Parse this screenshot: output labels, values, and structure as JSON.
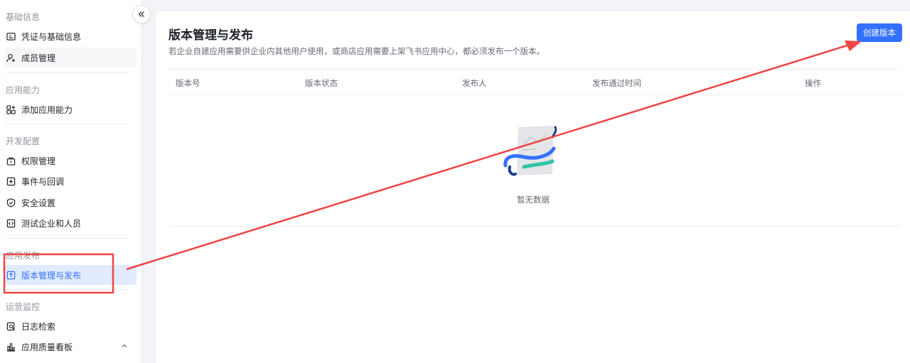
{
  "sidebar": {
    "sections": [
      {
        "title": "基础信息",
        "items": [
          {
            "label": "凭证与基础信息",
            "icon": "credential-icon"
          },
          {
            "label": "成员管理",
            "icon": "member-icon"
          }
        ]
      },
      {
        "title": "应用能力",
        "items": [
          {
            "label": "添加应用能力",
            "icon": "add-capability-icon"
          }
        ]
      },
      {
        "title": "开发配置",
        "items": [
          {
            "label": "权限管理",
            "icon": "lock-icon"
          },
          {
            "label": "事件与回调",
            "icon": "event-icon"
          },
          {
            "label": "安全设置",
            "icon": "shield-icon"
          },
          {
            "label": "测试企业和人员",
            "icon": "code-icon"
          }
        ]
      },
      {
        "title": "应用发布",
        "items": [
          {
            "label": "版本管理与发布",
            "icon": "upload-icon"
          }
        ]
      },
      {
        "title": "运营监控",
        "items": [
          {
            "label": "日志检索",
            "icon": "log-search-icon"
          },
          {
            "label": "应用质量看板",
            "icon": "bar-chart-icon"
          }
        ]
      }
    ],
    "active_item": "版本管理与发布"
  },
  "main": {
    "title": "版本管理与发布",
    "description": "若企业自建应用需要供企业内其他用户使用，或商店应用需要上架飞书应用中心，都必须发布一个版本。",
    "create_button": "创建版本",
    "table": {
      "columns": [
        "版本号",
        "版本状态",
        "发布人",
        "发布通过时间",
        "操作"
      ],
      "rows": [],
      "empty_text": "暂无数据"
    }
  },
  "colors": {
    "accent": "#3370ff",
    "active_bg": "#e1eaff",
    "annotation": "#ef4444"
  }
}
